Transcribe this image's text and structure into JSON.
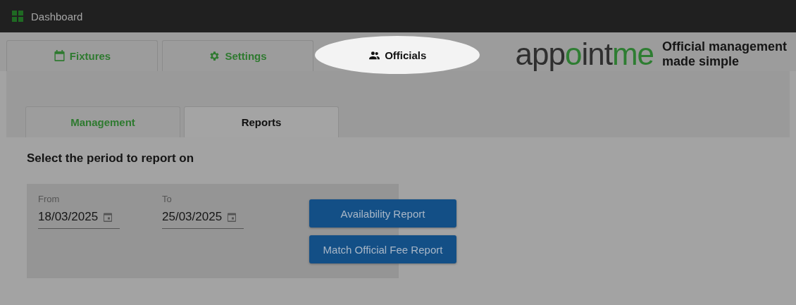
{
  "header": {
    "title": "Dashboard"
  },
  "tabs": [
    {
      "label": "Fixtures",
      "kind": "calendar",
      "selected": false
    },
    {
      "label": "Settings",
      "kind": "gear",
      "selected": false
    },
    {
      "label": "Officials",
      "kind": "people",
      "selected": true
    }
  ],
  "logo": {
    "parts": [
      {
        "text": "app",
        "color": "#2f2f2f"
      },
      {
        "text": "o",
        "color": "#2e7d32"
      },
      {
        "text": "int",
        "color": "#2f2f2f"
      },
      {
        "text": "me",
        "color": "#2e7d32"
      }
    ],
    "tagline": "Official management made simple"
  },
  "subtabs": [
    {
      "label": "Management",
      "selected": false
    },
    {
      "label": "Reports",
      "selected": true
    }
  ],
  "report": {
    "heading": "Select the period to report on",
    "fields": [
      {
        "label": "From",
        "value": "18/03/2025"
      },
      {
        "label": "To",
        "value": "25/03/2025"
      }
    ],
    "buttons": [
      "Availability Report",
      "Match Official Fee Report"
    ]
  }
}
